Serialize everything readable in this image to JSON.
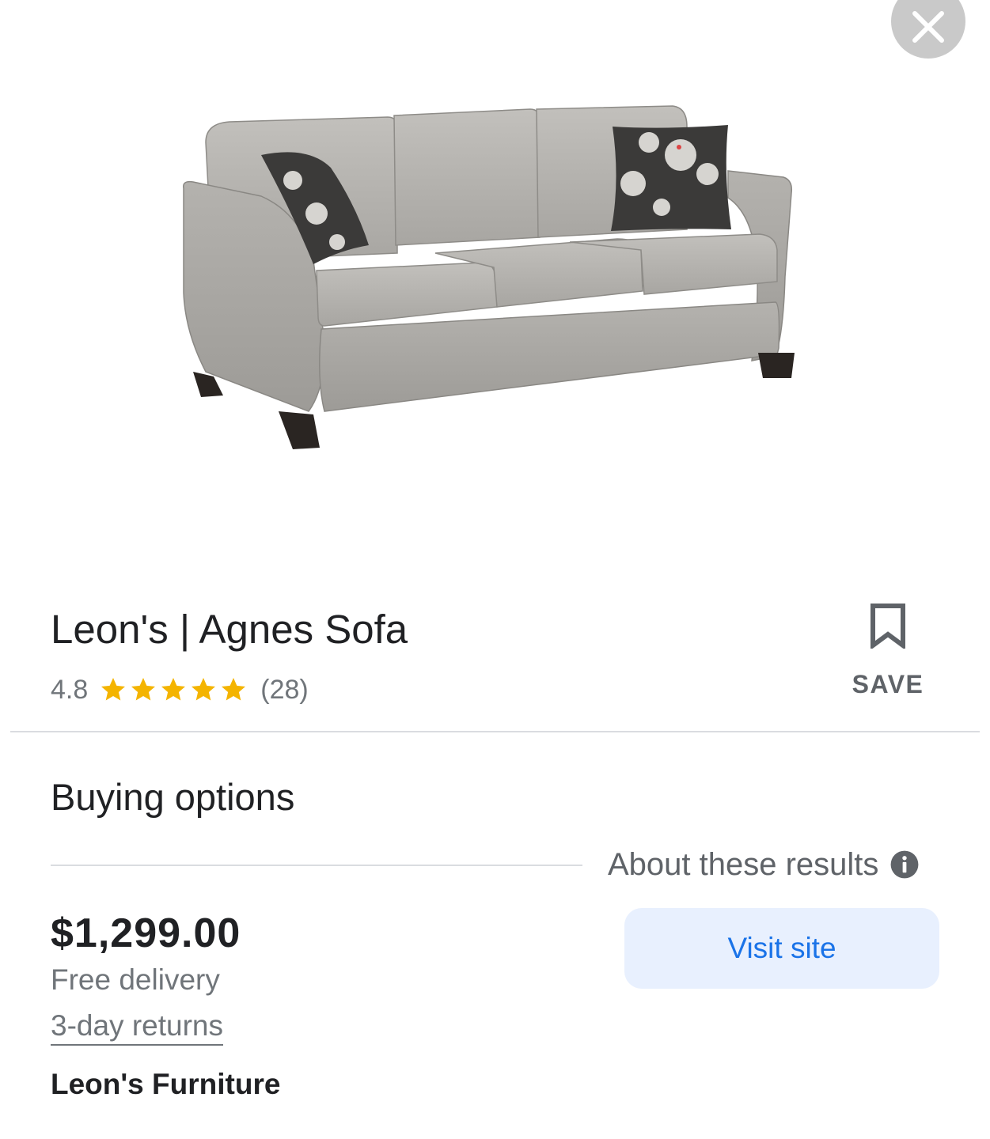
{
  "product": {
    "title": "Leon's | Agnes Sofa",
    "rating": "4.8",
    "stars": 5,
    "review_count": "(28)",
    "image_icon": "sofa-product-image"
  },
  "actions": {
    "save_label": "SAVE",
    "close_icon": "close-icon",
    "bookmark_icon": "bookmark-icon"
  },
  "buying_options": {
    "heading": "Buying options",
    "about_label": "About these results",
    "info_icon": "info-icon",
    "offer": {
      "price": "$1,299.00",
      "delivery": "Free delivery",
      "returns": "3-day returns",
      "seller": "Leon's Furniture",
      "visit_label": "Visit site"
    }
  },
  "colors": {
    "star": "#f4b400",
    "accent": "#1a73e8",
    "button_bg": "#e8f0fe",
    "muted_text": "#70757a"
  }
}
